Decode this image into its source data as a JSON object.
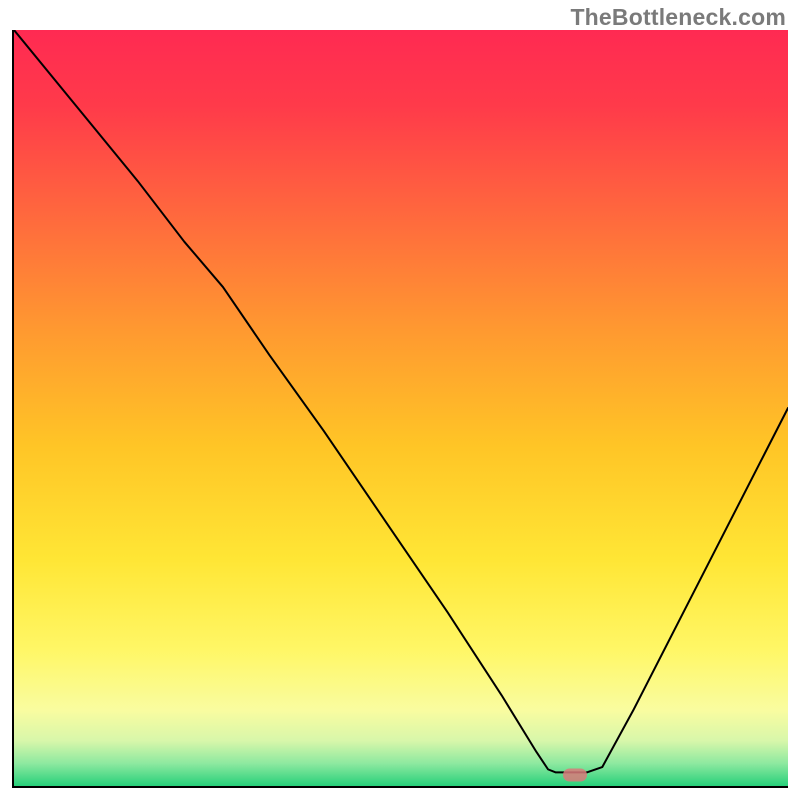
{
  "watermark": "TheBottleneck.com",
  "marker": {
    "color": "#d97a7a",
    "x_frac": 0.725,
    "y_frac": 0.985
  },
  "chart_data": {
    "type": "line",
    "title": "",
    "xlabel": "",
    "ylabel": "",
    "xlim": [
      0,
      1
    ],
    "ylim": [
      0,
      1
    ],
    "background": {
      "type": "vertical-gradient",
      "stops": [
        {
          "offset": 0.0,
          "color": "#ff2a52"
        },
        {
          "offset": 0.1,
          "color": "#ff3a4a"
        },
        {
          "offset": 0.25,
          "color": "#ff6a3d"
        },
        {
          "offset": 0.4,
          "color": "#ff9a30"
        },
        {
          "offset": 0.55,
          "color": "#ffc526"
        },
        {
          "offset": 0.7,
          "color": "#ffe635"
        },
        {
          "offset": 0.82,
          "color": "#fff766"
        },
        {
          "offset": 0.9,
          "color": "#f9fca0"
        },
        {
          "offset": 0.94,
          "color": "#d8f7aa"
        },
        {
          "offset": 0.97,
          "color": "#8ee9a0"
        },
        {
          "offset": 1.0,
          "color": "#27d07a"
        }
      ]
    },
    "series": [
      {
        "name": "bottleneck-curve",
        "color": "#000000",
        "stroke_width": 2,
        "points": [
          {
            "x": 0.0,
            "y": 1.0
          },
          {
            "x": 0.08,
            "y": 0.9
          },
          {
            "x": 0.16,
            "y": 0.8
          },
          {
            "x": 0.22,
            "y": 0.72
          },
          {
            "x": 0.27,
            "y": 0.66
          },
          {
            "x": 0.33,
            "y": 0.57
          },
          {
            "x": 0.4,
            "y": 0.47
          },
          {
            "x": 0.48,
            "y": 0.35
          },
          {
            "x": 0.56,
            "y": 0.23
          },
          {
            "x": 0.63,
            "y": 0.12
          },
          {
            "x": 0.675,
            "y": 0.045
          },
          {
            "x": 0.69,
            "y": 0.022
          },
          {
            "x": 0.7,
            "y": 0.018
          },
          {
            "x": 0.74,
            "y": 0.018
          },
          {
            "x": 0.76,
            "y": 0.025
          },
          {
            "x": 0.8,
            "y": 0.1
          },
          {
            "x": 0.86,
            "y": 0.22
          },
          {
            "x": 0.92,
            "y": 0.34
          },
          {
            "x": 0.97,
            "y": 0.44
          },
          {
            "x": 1.0,
            "y": 0.5
          }
        ]
      }
    ],
    "marker": {
      "x": 0.725,
      "y": 0.015,
      "color": "#d97a7a"
    }
  }
}
